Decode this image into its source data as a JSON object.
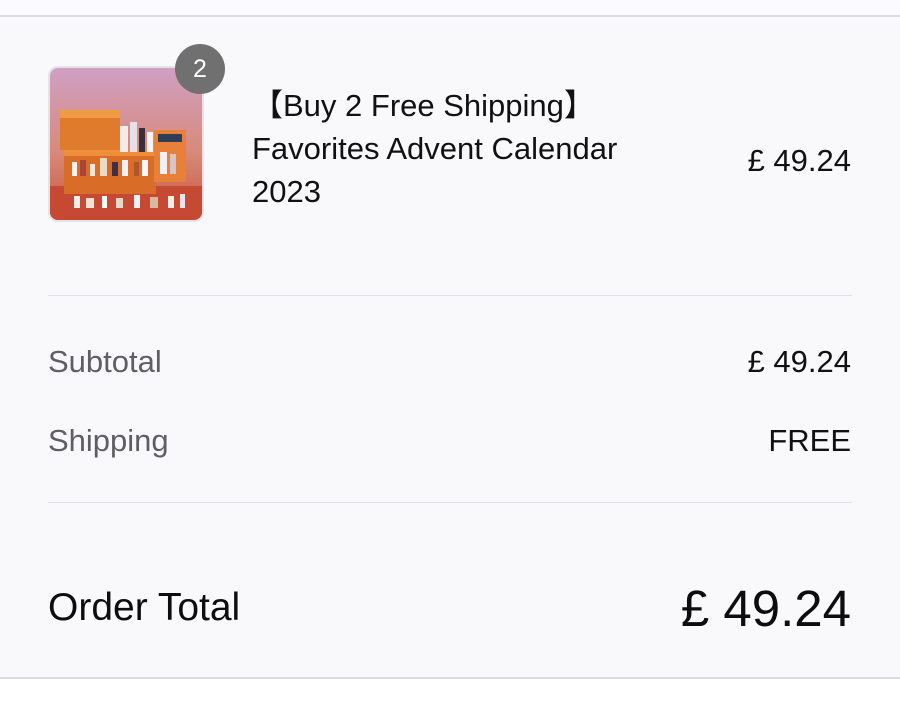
{
  "product": {
    "quantity": "2",
    "name": "【Buy 2 Free Shipping】\nFavorites Advent Calendar\n2023",
    "price": "£ 49.24",
    "image_icon": "product-thumbnail"
  },
  "summary": {
    "subtotal_label": "Subtotal",
    "subtotal_value": "£ 49.24",
    "shipping_label": "Shipping",
    "shipping_value": "FREE"
  },
  "total": {
    "label": "Order Total",
    "value": "£ 49.24"
  },
  "colors": {
    "background": "#f9f8fa",
    "badge": "#707070",
    "muted_text": "#5e5e63",
    "divider": "#e3e1e5"
  }
}
